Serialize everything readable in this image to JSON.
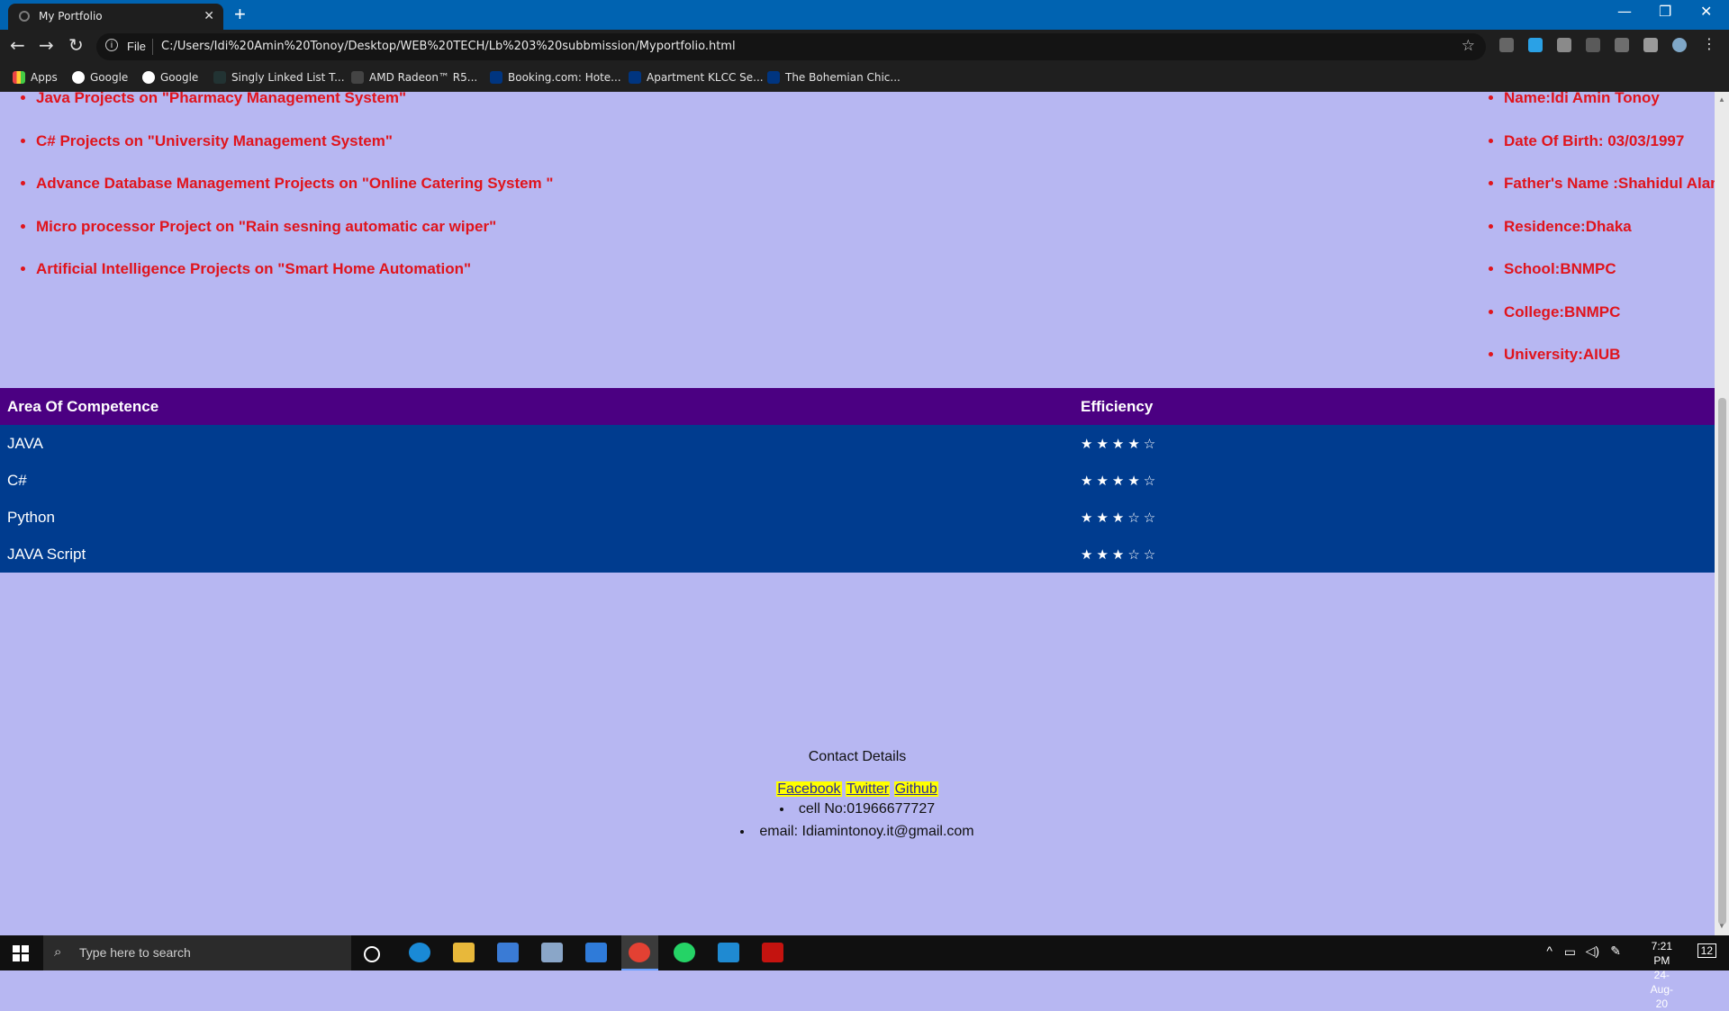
{
  "browser": {
    "tab_title": "My Portfolio",
    "url_scheme": "File",
    "url": "C:/Users/Idi%20Amin%20Tonoy/Desktop/WEB%20TECH/Lb%203%20subbmission/Myportfolio.html"
  },
  "bookmarks": [
    {
      "label": "Apps",
      "icon": "apps-grid-icon"
    },
    {
      "label": "Google",
      "icon": "google-icon"
    },
    {
      "label": "Google",
      "icon": "google-icon"
    },
    {
      "label": "Singly Linked List T...",
      "icon": "page-icon"
    },
    {
      "label": "AMD Radeon™ R5...",
      "icon": "amd-icon"
    },
    {
      "label": "Booking.com: Hote...",
      "icon": "booking-icon"
    },
    {
      "label": "Apartment KLCC Se...",
      "icon": "booking-icon"
    },
    {
      "label": "The Bohemian Chic...",
      "icon": "booking-icon"
    }
  ],
  "projects": [
    "Java Projects on \"Pharmacy Management System\"",
    "C# Projects on \"University Management System\"",
    "Advance Database Management Projects on \"Online Catering System \"",
    "Micro processor Project on \"Rain sesning automatic car wiper\"",
    "Artificial Intelligence Projects on \"Smart Home Automation\""
  ],
  "personal_info": [
    "Name:Idi Amin Tonoy",
    "Date Of Birth: 03/03/1997",
    "Father's Name :Shahidul Alam",
    "Residence:Dhaka",
    "School:BNMPC",
    "College:BNMPC",
    "University:AIUB"
  ],
  "skills_table": {
    "headers": [
      "Area Of Competence",
      "Efficiency"
    ],
    "rows": [
      {
        "area": "JAVA",
        "stars": "★★★★☆",
        "rating": 4,
        "max": 5
      },
      {
        "area": "C#",
        "stars": "★★★★☆",
        "rating": 4,
        "max": 5
      },
      {
        "area": "Python",
        "stars": "★★★☆☆",
        "rating": 3,
        "max": 5
      },
      {
        "area": "JAVA Script",
        "stars": "★★★☆☆",
        "rating": 3,
        "max": 5
      }
    ]
  },
  "contact": {
    "title": "Contact Details",
    "links": [
      "Facebook",
      "Twitter",
      "Github"
    ],
    "items": [
      "cell No:01966677727",
      "email: Idiamintonoy.it@gmail.com"
    ]
  },
  "taskbar": {
    "search_placeholder": "Type here to search",
    "time": "7:21 PM",
    "date": "24-Aug-20",
    "notification_count": "12"
  },
  "colors": {
    "page_bg": "#b7b7f2",
    "list_text": "#e0141c",
    "table_header": "#4b0082",
    "table_row": "#003c8f",
    "link_highlight": "#ffff00"
  }
}
